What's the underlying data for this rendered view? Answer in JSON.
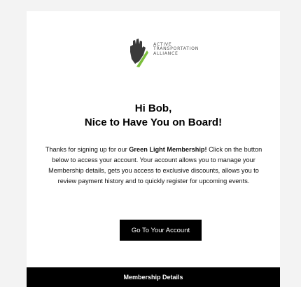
{
  "logo": {
    "icon": "raised-hand-logo-icon",
    "lines": [
      "ACTIVE",
      "TRANSPORTATION",
      "ALLIANCE"
    ],
    "colors": {
      "dark": "#3a3a3a",
      "green": "#7bbf3b"
    }
  },
  "greeting": {
    "hi": "Hi Bob,",
    "headline": "Nice to Have You on Board!"
  },
  "body": {
    "before": "Thanks for signing up for our ",
    "bold": "Green Light Membership!",
    "after": " Click on the button below to access your account. Your account allows you to manage your Membership details, gets you access to exclusive discounts, allows you to review payment history and to quickly register for upcoming events."
  },
  "cta": {
    "label": "Go To Your Account"
  },
  "section_bar": {
    "label": "Membership Details"
  }
}
